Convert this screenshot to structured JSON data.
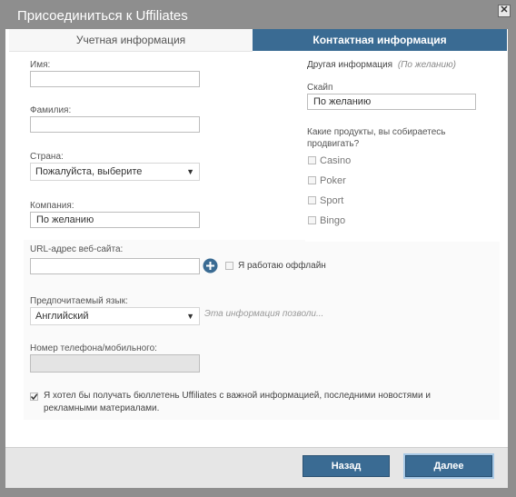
{
  "dialog": {
    "title": "Присоединиться к Uffiliates",
    "close_icon": "close-icon"
  },
  "tabs": [
    {
      "label": "Учетная информация",
      "active": false
    },
    {
      "label": "Контактная информация",
      "active": true
    }
  ],
  "left": {
    "first_name": {
      "label": "Имя:",
      "value": ""
    },
    "last_name": {
      "label": "Фамилия:",
      "value": ""
    },
    "country": {
      "label": "Страна:",
      "value": "Пожалуйста, выберите"
    },
    "company": {
      "label": "Компания:",
      "placeholder": "По желанию"
    },
    "website": {
      "label": "URL-адрес веб-сайта:",
      "value": ""
    },
    "offline_label": "Я работаю оффлайн",
    "language": {
      "label": "Предпочитаемый язык:",
      "value": "Английский",
      "hint": "Эта информация позволи..."
    },
    "phone": {
      "label": "Номер телефона/мобильного:",
      "value": ""
    },
    "newsletter": {
      "checked": true,
      "label_lines": [
        "Я хотел бы получать бюллетень Uffiliates с важной информацией, последними новостями и",
        "рекламными материалами."
      ]
    }
  },
  "right": {
    "section_label": "Другая информация",
    "section_hint": "(По желанию)",
    "skype": {
      "label": "Скайп",
      "placeholder": "По желанию"
    },
    "products_label_lines": [
      "Какие продукты, вы собираетесь",
      "продвигать?"
    ],
    "products": [
      "Casino",
      "Poker",
      "Sport",
      "Bingo"
    ]
  },
  "footer": {
    "back": "Назад",
    "next": "Далее"
  },
  "colors": {
    "accent": "#3a6b93",
    "titlebar": "#8e8e8e",
    "footer": "#e6e6e6"
  }
}
